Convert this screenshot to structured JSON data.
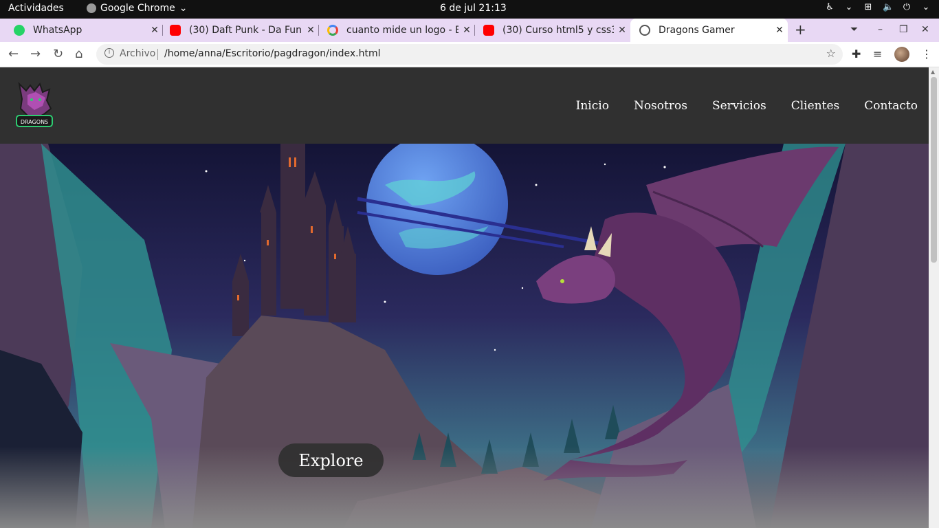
{
  "system": {
    "activities": "Actividades",
    "app_name": "Google Chrome",
    "clock": "6 de jul  21:13"
  },
  "tabs": [
    {
      "title": "WhatsApp",
      "favicon": "whatsapp-icon"
    },
    {
      "title": "(30) Daft Punk - Da Funk",
      "favicon": "youtube-icon"
    },
    {
      "title": "cuanto mide un logo - B",
      "favicon": "google-icon"
    },
    {
      "title": "(30) Curso html5 y css3 -",
      "favicon": "youtube-icon"
    },
    {
      "title": "Dragons Gamer",
      "favicon": "globe-icon",
      "active": true
    }
  ],
  "address_bar": {
    "protocol_label": "Archivo",
    "url": "/home/anna/Escritorio/pagdragon/index.html"
  },
  "site": {
    "logo_text": "DRAGONS",
    "nav": [
      "Inicio",
      "Nosotros",
      "Servicios",
      "Clientes",
      "Contacto"
    ],
    "hero_button": "Explore"
  },
  "colors": {
    "site_header": "#303030",
    "tab_strip": "#e8d8f4",
    "hero_sky": "#2b2a5e",
    "dragon": "#6b3a6e"
  }
}
